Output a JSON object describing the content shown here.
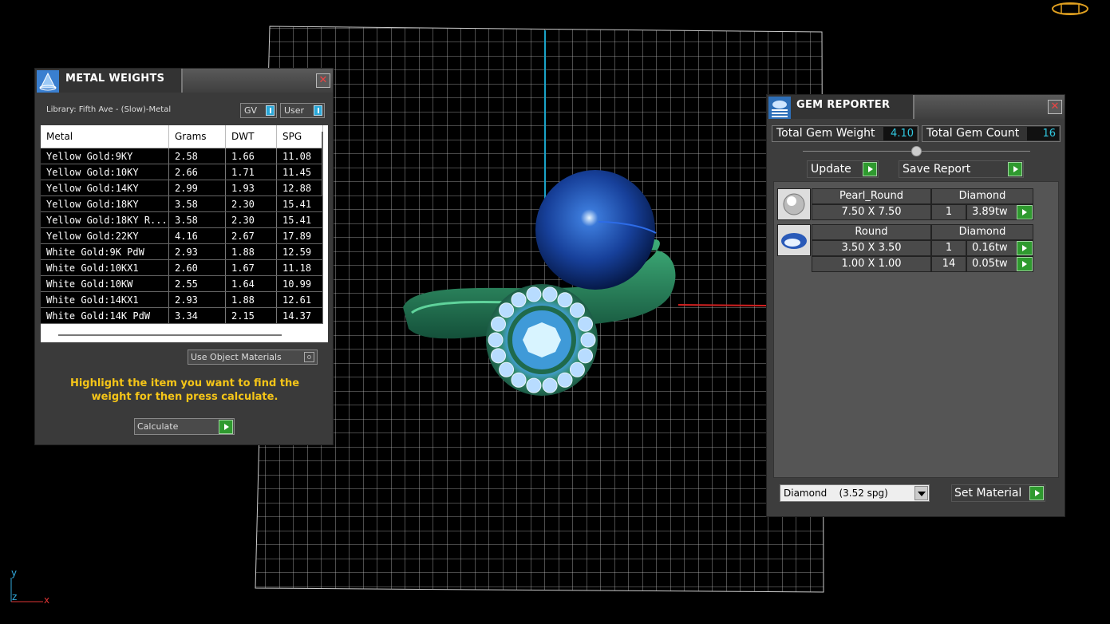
{
  "metal_weights": {
    "title": "METAL WEIGHTS",
    "library": "Library: Fifth Ave - (Slow)-Metal",
    "gv_label": "GV",
    "user_label": "User",
    "columns": [
      "Metal",
      "Grams",
      "DWT",
      "SPG"
    ],
    "rows": [
      [
        "Yellow Gold:9KY",
        "2.58",
        "1.66",
        "11.08"
      ],
      [
        "Yellow Gold:10KY",
        "2.66",
        "1.71",
        "11.45"
      ],
      [
        "Yellow Gold:14KY",
        "2.99",
        "1.93",
        "12.88"
      ],
      [
        "Yellow Gold:18KY",
        "3.58",
        "2.30",
        "15.41"
      ],
      [
        "Yellow Gold:18KY R...",
        "3.58",
        "2.30",
        "15.41"
      ],
      [
        "Yellow Gold:22KY",
        "4.16",
        "2.67",
        "17.89"
      ],
      [
        "White Gold:9K PdW",
        "2.93",
        "1.88",
        "12.59"
      ],
      [
        "White Gold:10KX1",
        "2.60",
        "1.67",
        "11.18"
      ],
      [
        "White Gold:10KW",
        "2.55",
        "1.64",
        "10.99"
      ],
      [
        "White Gold:14KX1",
        "2.93",
        "1.88",
        "12.61"
      ],
      [
        "White Gold:14K PdW",
        "3.34",
        "2.15",
        "14.37"
      ]
    ],
    "use_object_materials": "Use Object Materials",
    "hint": "Highlight the item you want to find the weight for then press calculate.",
    "calculate_label": "Calculate"
  },
  "gem_reporter": {
    "title": "GEM REPORTER",
    "total_weight_label": "Total Gem Weight",
    "total_weight_value": "4.10",
    "total_count_label": "Total Gem Count",
    "total_count_value": "16",
    "update_label": "Update",
    "save_report_label": "Save Report",
    "groups": [
      {
        "shape": "Pearl_Round",
        "material": "Diamond",
        "rows": [
          {
            "size": "7.50 X 7.50",
            "count": "1",
            "weight": "3.89tw"
          }
        ]
      },
      {
        "shape": "Round",
        "material": "Diamond",
        "rows": [
          {
            "size": "3.50 X 3.50",
            "count": "1",
            "weight": "0.16tw"
          },
          {
            "size": "1.00 X 1.00",
            "count": "14",
            "weight": "0.05tw"
          }
        ]
      }
    ],
    "material_select": "Diamond    (3.52 spg)",
    "set_material_label": "Set Material"
  },
  "axis": {
    "y": "y",
    "z": "z",
    "x": "x"
  },
  "colors": {
    "accent_green": "#2f9a2f",
    "value_cyan": "#30c8e0",
    "hint_yellow": "#f5c518",
    "ring_green": "#2a8a5c",
    "pearl_blue": "#1c3f9a"
  }
}
